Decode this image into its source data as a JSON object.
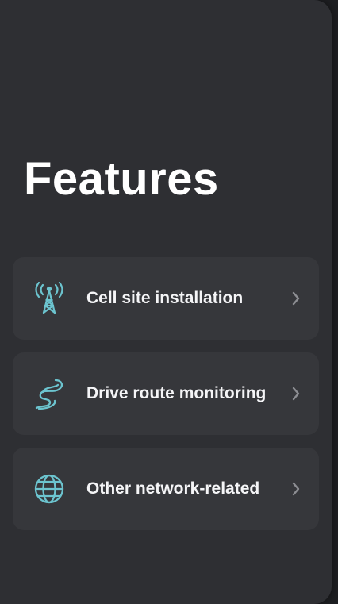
{
  "page": {
    "title": "Features"
  },
  "colors": {
    "accent": "#6cc4cf",
    "panel": "#2e2f33",
    "card": "#36373b",
    "chevron": "#8d8e93"
  },
  "features": [
    {
      "label": "Cell site installation",
      "icon": "cell-tower-icon"
    },
    {
      "label": "Drive route monitoring",
      "icon": "route-icon"
    },
    {
      "label": "Other network-related",
      "icon": "globe-icon"
    }
  ]
}
